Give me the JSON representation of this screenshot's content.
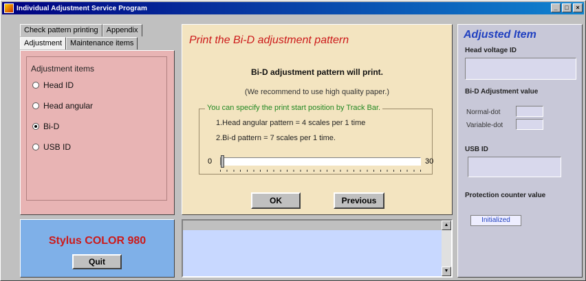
{
  "window": {
    "title": "Individual Adjustment Service Program",
    "controls": [
      "_",
      "□",
      "×"
    ]
  },
  "tabs": {
    "row1": [
      "Check pattern printing",
      "Appendix"
    ],
    "row2": [
      "Adjustment",
      "Maintenance items"
    ],
    "active": "Adjustment"
  },
  "adjustment_items": {
    "title": "Adjustment items",
    "options": [
      {
        "label": "Head ID",
        "selected": false
      },
      {
        "label": "Head angular",
        "selected": false
      },
      {
        "label": "Bi-D",
        "selected": true
      },
      {
        "label": "USB ID",
        "selected": false
      }
    ]
  },
  "model": {
    "name": "Stylus COLOR 980",
    "quit_label": "Quit"
  },
  "center": {
    "title": "Print the Bi-D adjustment pattern",
    "subtitle": "Bi-D adjustment pattern will print.",
    "recommend": "(We recommend to use high quality paper.)",
    "group_legend": "You can specify the print start position by Track Bar.",
    "line1": "1.Head angular pattern  =  4 scales per 1 time",
    "line2": "2.Bi-d pattern              =  7 scales per 1 time.",
    "track_min": "0",
    "track_max": "30",
    "track_value": 0,
    "ok_label": "OK",
    "previous_label": "Previous"
  },
  "right": {
    "title": "Adjusted Item",
    "head_voltage_label": "Head voltage ID",
    "bid_label": "Bi-D Adjustment value",
    "normal_label": "Normal-dot",
    "variable_label": "Variable-dot",
    "usb_label": "USB ID",
    "protection_label": "Protection counter value",
    "protection_value": "Initialized"
  }
}
